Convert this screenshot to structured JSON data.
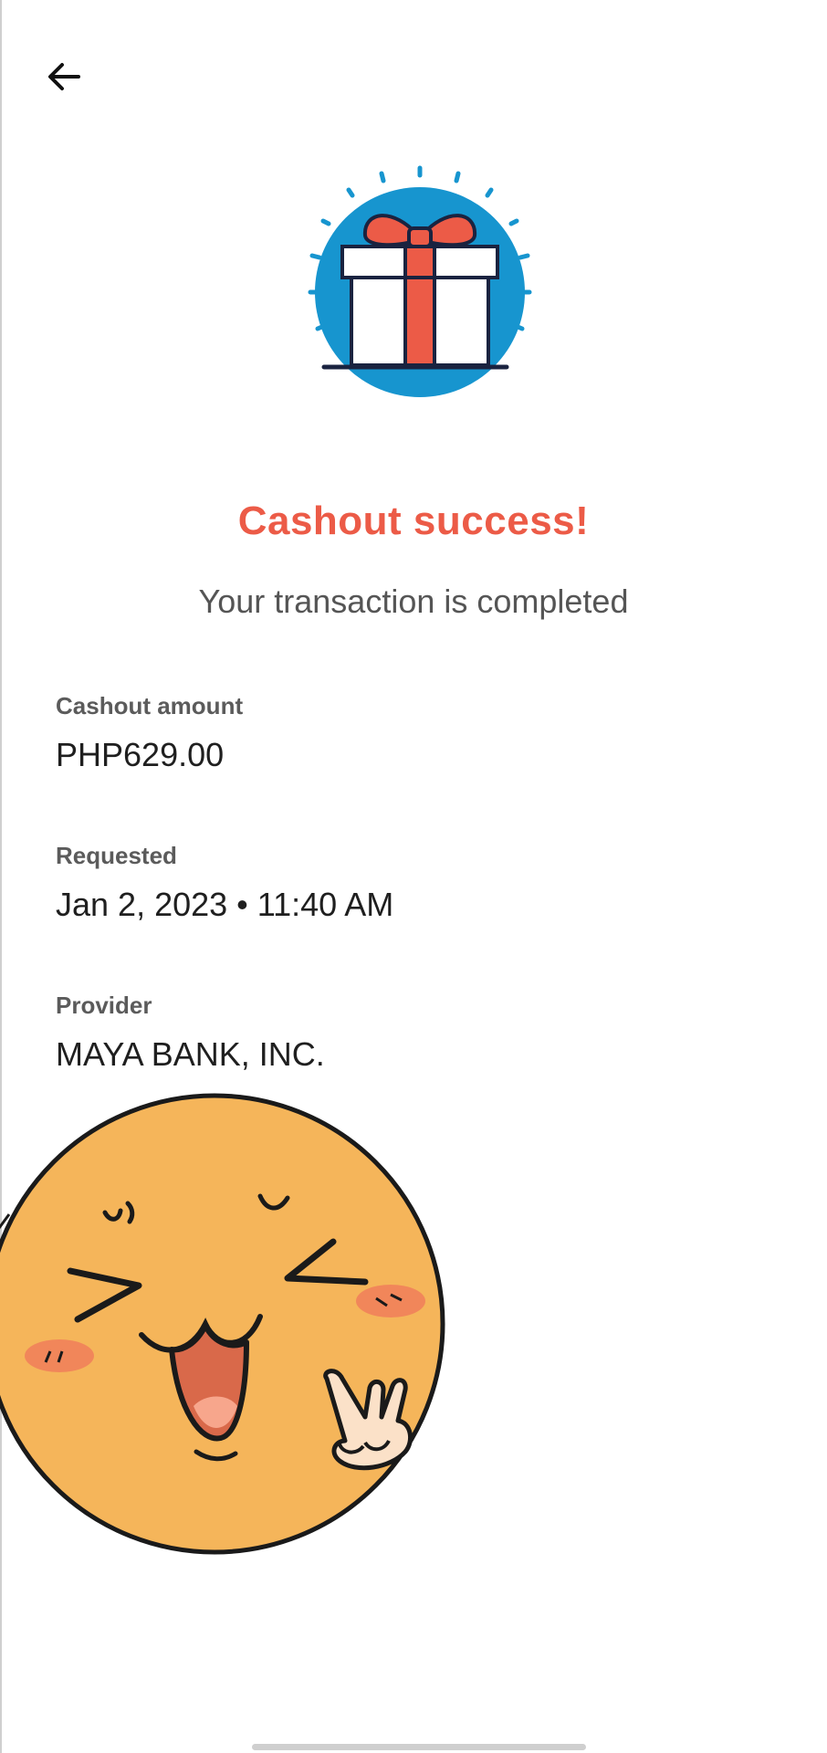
{
  "header": {
    "back_icon": "arrow-left-icon"
  },
  "hero": {
    "icon": "gift-box-icon",
    "accent_color": "#ec5b47",
    "circle_color": "#1795cf"
  },
  "status": {
    "title": "Cashout success!",
    "subtitle": "Your transaction is completed"
  },
  "details": {
    "cashout_amount": {
      "label": "Cashout amount",
      "value": "PHP629.00"
    },
    "requested": {
      "label": "Requested",
      "value": "Jan 2, 2023 • 11:40 AM"
    },
    "provider": {
      "label": "Provider",
      "value": "MAYA BANK, INC."
    }
  },
  "overlay": {
    "sticker": "laughing-face-sticker"
  }
}
